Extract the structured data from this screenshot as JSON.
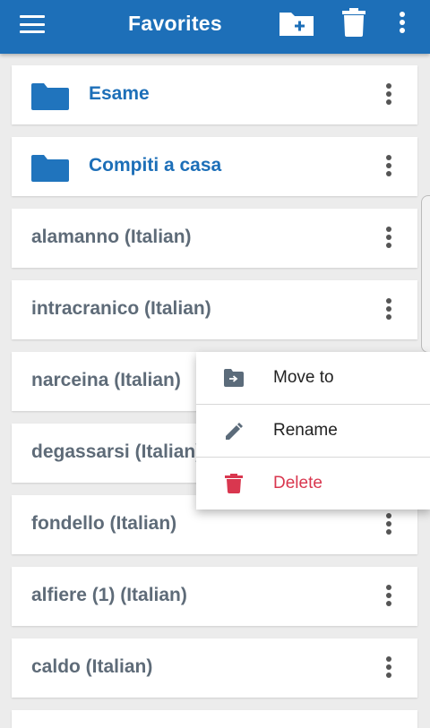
{
  "appbar": {
    "title": "Favorites",
    "menu_icon": "hamburger-menu-icon",
    "new_folder_icon": "new-folder-icon",
    "trash_icon": "trash-icon",
    "overflow_icon": "more-vert-icon",
    "color": "#1d6fb8"
  },
  "folders": [
    {
      "label": "Esame"
    },
    {
      "label": "Compiti a casa"
    }
  ],
  "words": [
    {
      "label": "alamanno (Italian)"
    },
    {
      "label": "intracranico (Italian)"
    },
    {
      "label": "narceina (Italian)"
    },
    {
      "label": "degassarsi (Italian)"
    },
    {
      "label": "fondello (Italian)"
    },
    {
      "label": "alfiere (1) (Italian)"
    },
    {
      "label": "caldo (Italian)"
    }
  ],
  "context_menu": {
    "items": [
      {
        "label": "Move to",
        "icon": "move-to-folder-icon"
      },
      {
        "label": "Rename",
        "icon": "pencil-icon"
      },
      {
        "label": "Delete",
        "icon": "trash-icon",
        "color": "#d9374f"
      }
    ]
  }
}
